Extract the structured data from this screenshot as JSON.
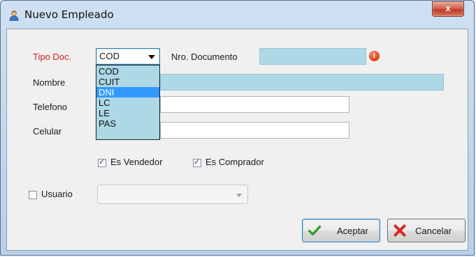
{
  "window": {
    "title": "Nuevo Empleado",
    "close_glyph": "x"
  },
  "form": {
    "tipo_doc_label": "Tipo Doc.",
    "tipo_doc_value": "COD",
    "tipo_doc_options": [
      "COD",
      "CUIT",
      "DNI",
      "LC",
      "LE",
      "PAS"
    ],
    "tipo_doc_highlighted": "DNI",
    "nro_documento_label": "Nro. Documento",
    "nro_documento_value": "",
    "error_glyph": "!",
    "nombre_label": "Nombre",
    "nombre_value": "",
    "telefono_label": "Telefono",
    "telefono_value": "",
    "celular_label": "Celular",
    "celular_value": "",
    "es_vendedor_label": "Es Vendedor",
    "es_vendedor_checked": true,
    "es_comprador_label": "Es Comprador",
    "es_comprador_checked": true,
    "usuario_label": "Usuario",
    "usuario_checked": false,
    "usuario_value": ""
  },
  "buttons": {
    "aceptar_label": "Aceptar",
    "cancelar_label": "Cancelar"
  },
  "colors": {
    "required_label": "#d4211f",
    "field_highlight": "#add8e6",
    "selection": "#3399ff"
  },
  "icons": {
    "title": "user-icon",
    "error": "error-icon",
    "aceptar": "check-icon",
    "cancelar": "cancel-x-icon"
  }
}
